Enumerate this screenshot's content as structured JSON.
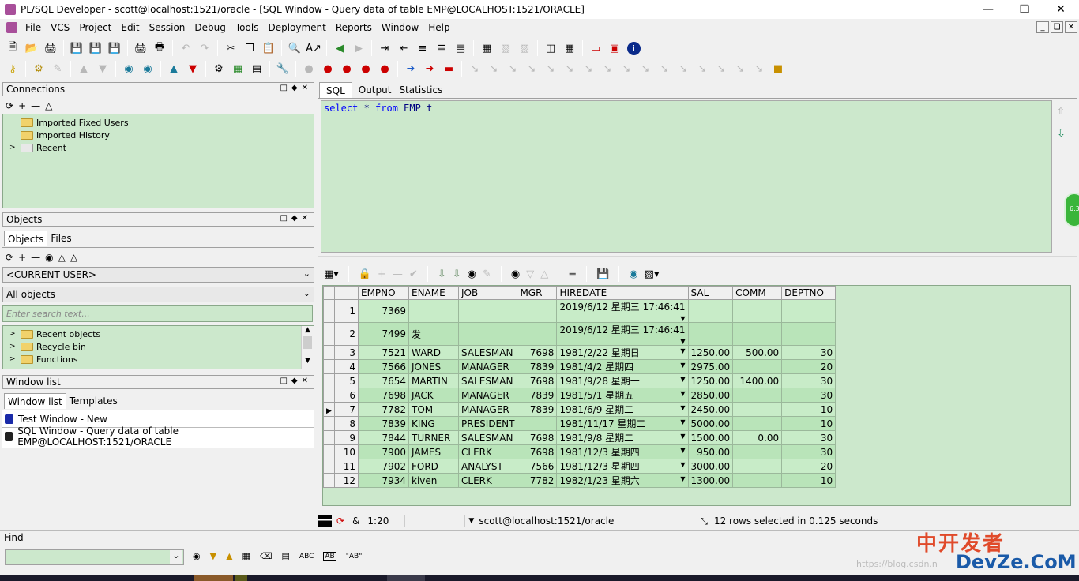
{
  "window": {
    "title": "PL/SQL Developer - scott@localhost:1521/oracle - [SQL Window - Query data of table EMP@LOCALHOST:1521/ORACLE]"
  },
  "menu": [
    "File",
    "VCS",
    "Project",
    "Edit",
    "Session",
    "Debug",
    "Tools",
    "Deployment",
    "Reports",
    "Window",
    "Help"
  ],
  "connections": {
    "title": "Connections",
    "items": [
      "Imported Fixed Users",
      "Imported History",
      "Recent"
    ]
  },
  "objects": {
    "title": "Objects",
    "tabs": [
      "Objects",
      "Files"
    ],
    "user_select": "<CURRENT USER>",
    "filter_select": "All objects",
    "search_placeholder": "Enter search text...",
    "items": [
      "Recent objects",
      "Recycle bin",
      "Functions"
    ]
  },
  "windowlist": {
    "title": "Window list",
    "tabs": [
      "Window list",
      "Templates"
    ],
    "items": [
      "Test Window - New",
      "SQL Window - Query data of table EMP@LOCALHOST:1521/ORACLE"
    ]
  },
  "editor": {
    "tabs": [
      "SQL",
      "Output",
      "Statistics"
    ],
    "sql": {
      "kw1": "select",
      "star": " * ",
      "kw2": "from",
      "tbl": " EMP t"
    },
    "side_badge": "6.3"
  },
  "grid": {
    "columns": [
      "EMPNO",
      "ENAME",
      "JOB",
      "MGR",
      "HIREDATE",
      "SAL",
      "COMM",
      "DEPTNO"
    ],
    "rows": [
      {
        "n": "1",
        "empno": "7369",
        "ename": "",
        "job": "",
        "mgr": "",
        "hiredate": "2019/6/12 星期三 17:46:41",
        "sal": "",
        "comm": "",
        "deptno": ""
      },
      {
        "n": "2",
        "empno": "7499",
        "ename": "发",
        "job": "",
        "mgr": "",
        "hiredate": "2019/6/12 星期三 17:46:41",
        "sal": "",
        "comm": "",
        "deptno": ""
      },
      {
        "n": "3",
        "empno": "7521",
        "ename": "WARD",
        "job": "SALESMAN",
        "mgr": "7698",
        "hiredate": "1981/2/22 星期日",
        "sal": "1250.00",
        "comm": "500.00",
        "deptno": "30"
      },
      {
        "n": "4",
        "empno": "7566",
        "ename": "JONES",
        "job": "MANAGER",
        "mgr": "7839",
        "hiredate": "1981/4/2 星期四",
        "sal": "2975.00",
        "comm": "",
        "deptno": "20"
      },
      {
        "n": "5",
        "empno": "7654",
        "ename": "MARTIN",
        "job": "SALESMAN",
        "mgr": "7698",
        "hiredate": "1981/9/28 星期一",
        "sal": "1250.00",
        "comm": "1400.00",
        "deptno": "30"
      },
      {
        "n": "6",
        "empno": "7698",
        "ename": "JACK",
        "job": "MANAGER",
        "mgr": "7839",
        "hiredate": "1981/5/1 星期五",
        "sal": "2850.00",
        "comm": "",
        "deptno": "30"
      },
      {
        "n": "7",
        "empno": "7782",
        "ename": "TOM",
        "job": "MANAGER",
        "mgr": "7839",
        "hiredate": "1981/6/9 星期二",
        "sal": "2450.00",
        "comm": "",
        "deptno": "10"
      },
      {
        "n": "8",
        "empno": "7839",
        "ename": "KING",
        "job": "PRESIDENT",
        "mgr": "",
        "hiredate": "1981/11/17 星期二",
        "sal": "5000.00",
        "comm": "",
        "deptno": "10"
      },
      {
        "n": "9",
        "empno": "7844",
        "ename": "TURNER",
        "job": "SALESMAN",
        "mgr": "7698",
        "hiredate": "1981/9/8 星期二",
        "sal": "1500.00",
        "comm": "0.00",
        "deptno": "30"
      },
      {
        "n": "10",
        "empno": "7900",
        "ename": "JAMES",
        "job": "CLERK",
        "mgr": "7698",
        "hiredate": "1981/12/3 星期四",
        "sal": "950.00",
        "comm": "",
        "deptno": "30"
      },
      {
        "n": "11",
        "empno": "7902",
        "ename": "FORD",
        "job": "ANALYST",
        "mgr": "7566",
        "hiredate": "1981/12/3 星期四",
        "sal": "3000.00",
        "comm": "",
        "deptno": "20"
      },
      {
        "n": "12",
        "empno": "7934",
        "ename": "kiven",
        "job": "CLERK",
        "mgr": "7782",
        "hiredate": "1982/1/23 星期六",
        "sal": "1300.00",
        "comm": "",
        "deptno": "10"
      }
    ]
  },
  "status": {
    "position": "1:20",
    "connection": "scott@localhost:1521/oracle",
    "message": "12 rows selected in 0.125 seconds"
  },
  "find": {
    "title": "Find",
    "labels": [
      "ABC",
      "AB",
      "\"AB\""
    ]
  },
  "watermark": {
    "text": "中开发者",
    "sub": "DevZe.CoM",
    "url": "https://blog.csdn.n"
  },
  "colors": {
    "green_bg": "#cce8cc",
    "row_a": "#c8ecc8",
    "row_b": "#b9e4b9",
    "keyword": "#0000ff"
  }
}
